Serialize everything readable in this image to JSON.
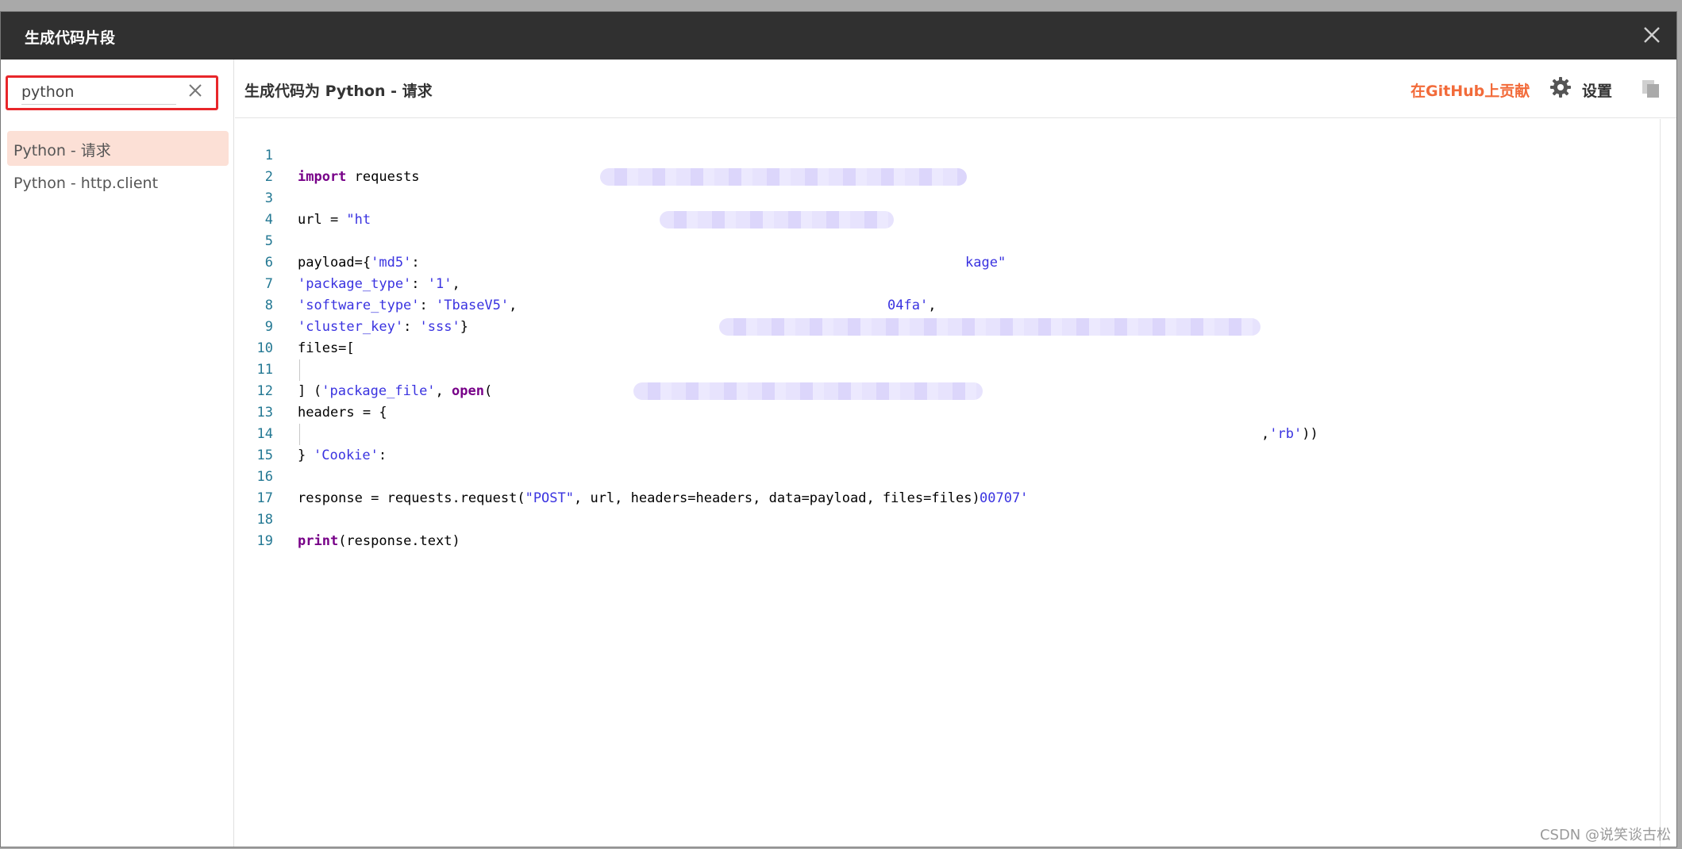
{
  "modal": {
    "title": "生成代码片段"
  },
  "sidebar": {
    "search": {
      "value": "python"
    },
    "items": [
      {
        "label": "Python - 请求"
      },
      {
        "label": "Python - http.client"
      }
    ]
  },
  "main": {
    "header_label": "生成代码为 Python - 请求",
    "github_link": "在GitHub上贡献",
    "settings_label": "设置"
  },
  "code": {
    "line_numbers": [
      "1",
      "2",
      "3",
      "4",
      "5",
      "6",
      "7",
      "8",
      "9",
      "10",
      "11",
      "12",
      "13",
      "14",
      "15",
      "16",
      "17",
      "18",
      "19"
    ],
    "l1_kw": "import",
    "l1_rest": " requests",
    "l3_a": "url = ",
    "l3_b": "\"ht",
    "l3_c": "kage\"",
    "l5_a": "payload={",
    "l5_b": "'md5'",
    "l5_c": ": ",
    "l5_d": "04fa'",
    "l5_e": ",",
    "l6_a": "'package_type'",
    "l6_b": ": ",
    "l6_c": "'1'",
    "l6_d": ",",
    "l7_a": "'software_type'",
    "l7_b": ": ",
    "l7_c": "'TbaseV5'",
    "l7_d": ",",
    "l8_a": "'cluster_key'",
    "l8_b": ": ",
    "l8_c": "'sss'",
    "l8_d": "}",
    "l9": "files=[",
    "l10_a": "(",
    "l10_b": "'package_file'",
    "l10_c": ", ",
    "l10_d": "open",
    "l10_e": "(",
    "l10_f": ",",
    "l10_g": "'rb'",
    "l10_h": "))",
    "l11": "]",
    "l12": "headers = {",
    "l13_a": "'Cookie'",
    "l13_b": ": ",
    "l13_c": "00707'",
    "l14": "}",
    "l16_a": "response = requests.request(",
    "l16_b": "\"POST\"",
    "l16_c": ", url, headers=headers, data=payload, files=files)",
    "l18_a": "print",
    "l18_b": "(response.text)"
  },
  "watermark": "CSDN @说笑谈古松",
  "colors": {
    "accent": "#f26b3a",
    "selected_bg": "#fce0d6",
    "highlight_box": "#e8262a",
    "titlebar": "#303030"
  }
}
